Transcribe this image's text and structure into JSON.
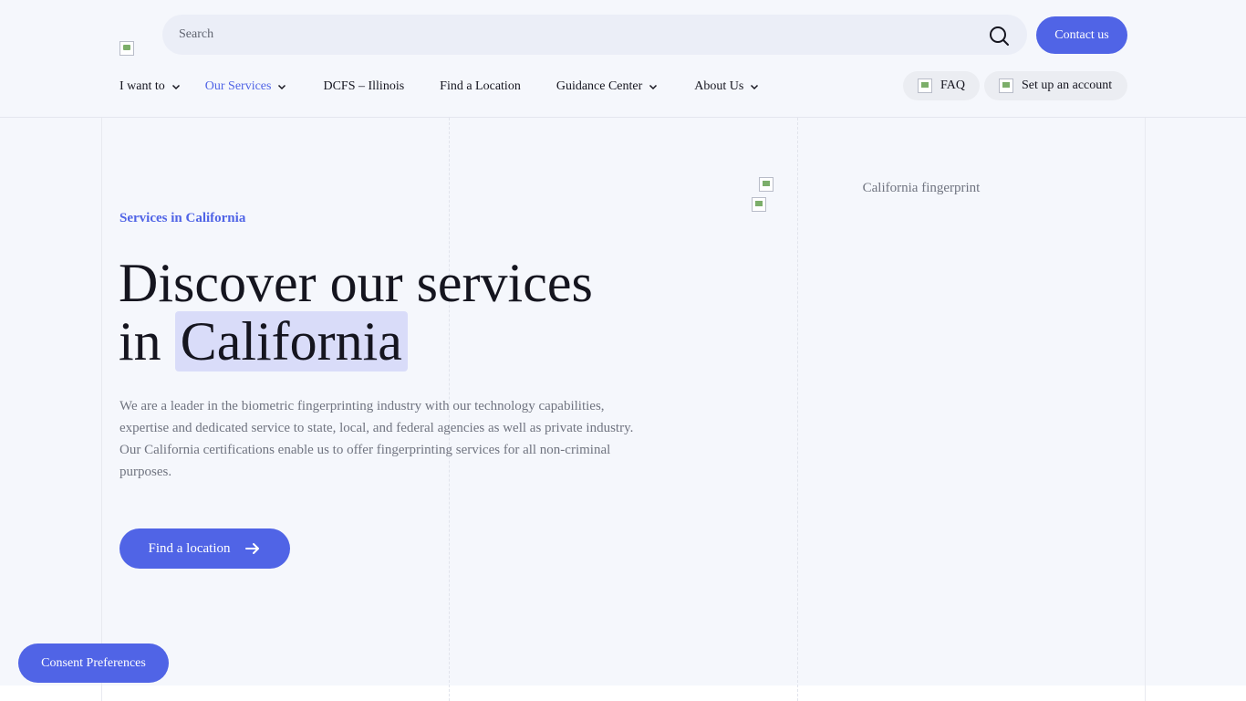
{
  "header": {
    "search": {
      "placeholder": "Search"
    },
    "contact_label": "Contact us",
    "nav": [
      {
        "label": "I want to",
        "has_dropdown": true,
        "active": false
      },
      {
        "label": "Our Services",
        "has_dropdown": true,
        "active": true
      },
      {
        "label": "DCFS – Illinois",
        "has_dropdown": false,
        "active": false
      },
      {
        "label": "Find a Location",
        "has_dropdown": false,
        "active": false
      },
      {
        "label": "Guidance Center",
        "has_dropdown": true,
        "active": false
      },
      {
        "label": "About Us",
        "has_dropdown": true,
        "active": false
      }
    ],
    "faq_label": "FAQ",
    "account_label": "Set up an account"
  },
  "hero": {
    "eyebrow": "Services in California",
    "headline_line1": "Discover our services",
    "headline_prefix": "in",
    "headline_highlight": "California",
    "description": "We are a leader in the biometric fingerprinting industry with our technology capabilities, expertise and dedicated service to state, local, and federal agencies as well as private industry. Our California certifications enable us to offer fingerprinting services for all non-criminal purposes.",
    "cta_label": "Find a location",
    "image_alt": "California fingerprint"
  },
  "consent_label": "Consent Preferences",
  "colors": {
    "accent": "#5064e6",
    "highlight_bg": "#d9dcf9",
    "page_bg": "#f5f7fc"
  },
  "icons": {
    "search": "search-icon",
    "chevron": "chevron-down-icon",
    "arrow": "arrow-right-icon"
  }
}
